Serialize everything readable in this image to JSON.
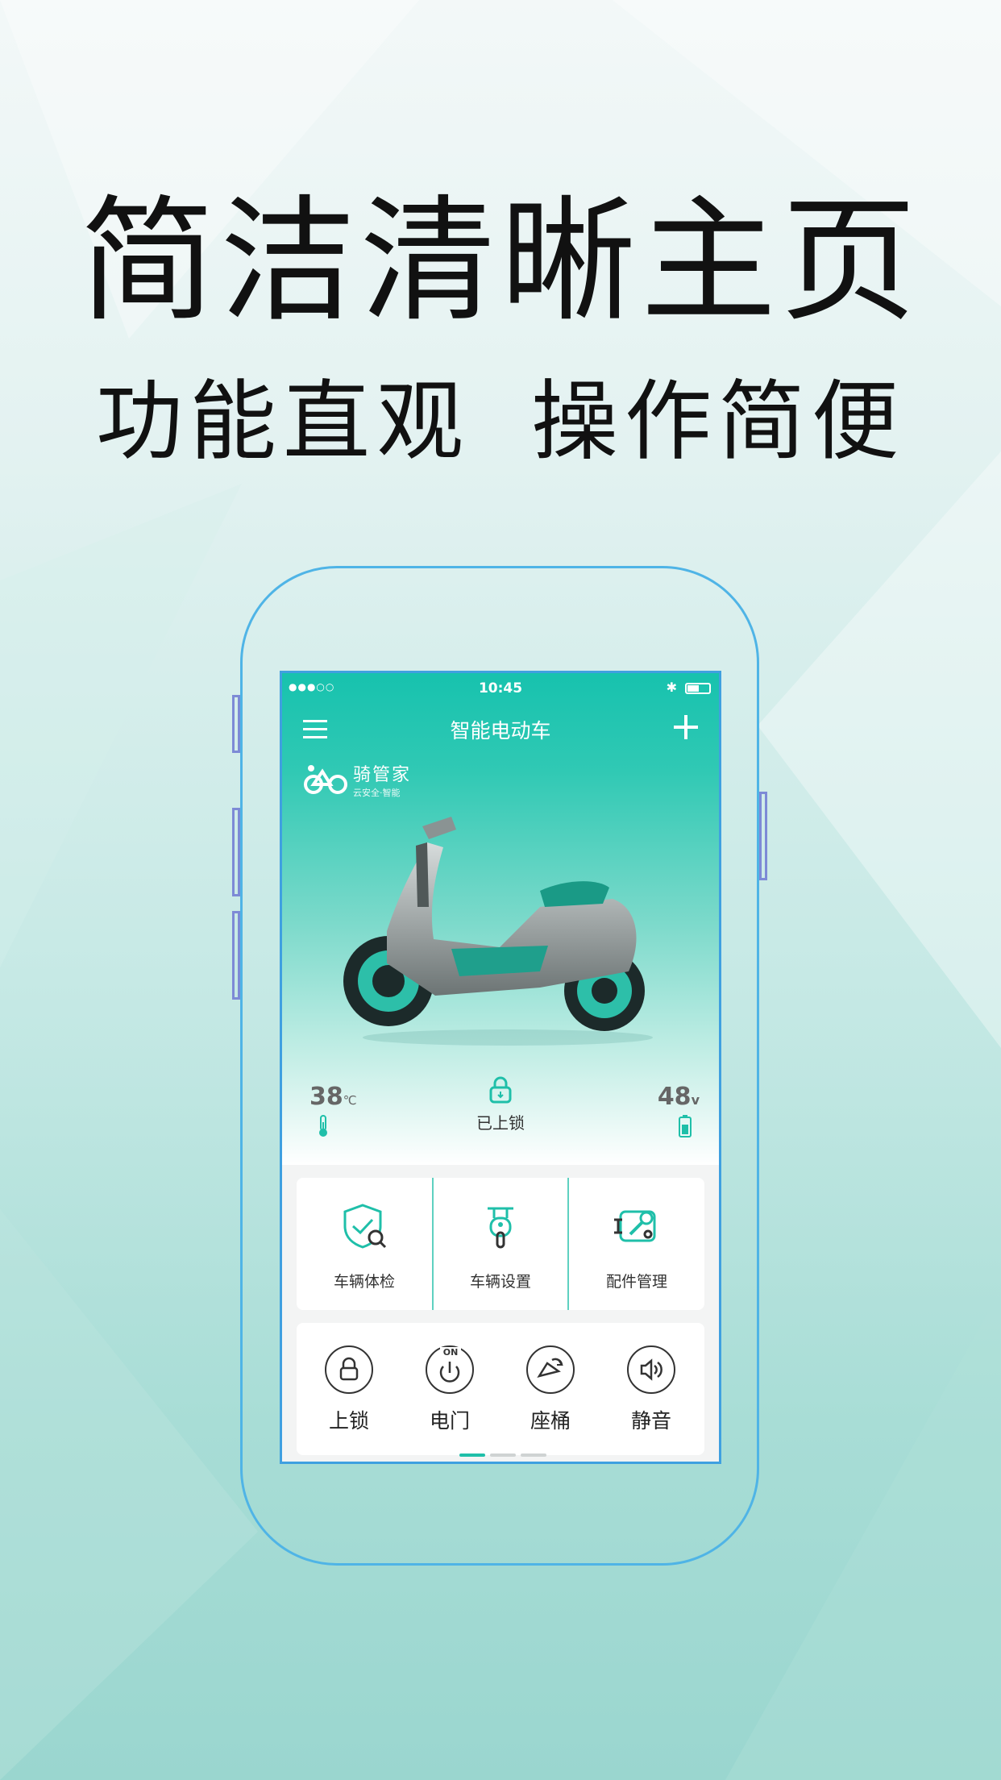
{
  "promo": {
    "headline": "简洁清晰主页",
    "subline_left": "功能直观",
    "subline_right": "操作简便"
  },
  "status_bar": {
    "time": "10:45",
    "signal": "●●●○○",
    "bluetooth": "bluetooth-icon",
    "battery": "battery-icon"
  },
  "app": {
    "title": "智能电动车",
    "brand_name": "骑管家",
    "brand_tagline": "云安全·智能",
    "colors": {
      "accent": "#17c2ae",
      "frame": "#4fb4e6"
    }
  },
  "stats": {
    "temperature_value": "38",
    "temperature_unit": "℃",
    "lock_label": "已上锁",
    "voltage_value": "48",
    "voltage_unit": "v"
  },
  "features": [
    {
      "label": "车辆体检",
      "icon": "shield-search-icon"
    },
    {
      "label": "车辆设置",
      "icon": "scooter-front-icon"
    },
    {
      "label": "配件管理",
      "icon": "wrench-settings-icon"
    }
  ],
  "controls": [
    {
      "label": "上锁",
      "icon": "lock-icon"
    },
    {
      "label": "电门",
      "icon": "power-on-icon",
      "badge": "ON"
    },
    {
      "label": "座桶",
      "icon": "seat-icon"
    },
    {
      "label": "静音",
      "icon": "speaker-icon"
    }
  ],
  "pager": {
    "pages": 3,
    "active": 1
  }
}
